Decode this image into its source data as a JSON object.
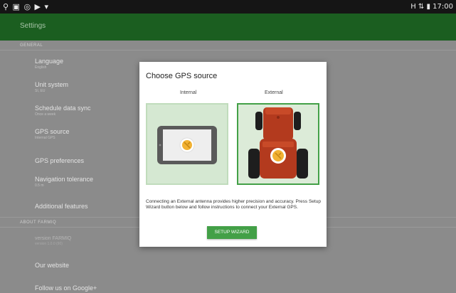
{
  "status_bar": {
    "left_icons": "⚲ ▣ ◎ ▶ ▾",
    "right_text": "H ⇅ ▮ 17:00"
  },
  "toolbar": {
    "title": "Settings"
  },
  "settings": {
    "section_general": "GENERAL",
    "items": [
      {
        "title": "Language",
        "subtitle": "English"
      },
      {
        "title": "Unit system",
        "subtitle": "SI, EU"
      },
      {
        "title": "Schedule data sync",
        "subtitle": "Once a week"
      },
      {
        "title": "GPS source",
        "subtitle": "Internal GPS"
      },
      {
        "title": "GPS preferences",
        "subtitle": ""
      },
      {
        "title": "Navigation tolerance",
        "subtitle": "0.5 m"
      },
      {
        "title": "Additional features",
        "subtitle": ""
      }
    ],
    "section_about": "ABOUT FARMIQ",
    "about_items": [
      {
        "title": "version FARMIQ",
        "subtitle": "version 1.0.0 (90)"
      },
      {
        "title": "Our website",
        "subtitle": ""
      },
      {
        "title": "Follow us on Google+",
        "subtitle": ""
      }
    ]
  },
  "dialog": {
    "title": "Choose GPS source",
    "internal_label": "Internal",
    "external_label": "External",
    "description": "Connecting an External antenna provides higher precision and accuracy. Press Setup Wizard button below and follow instructions to connect your External GPS.",
    "button_label": "SETUP WIZARD",
    "selected": "External"
  },
  "colors": {
    "toolbar": "#1b5e20",
    "accent": "#43a047",
    "tractor": "#b33a1e",
    "gps_marker": "#f2b233"
  },
  "icons": [
    "tablet-icon",
    "tractor-icon",
    "gps-marker-icon"
  ]
}
